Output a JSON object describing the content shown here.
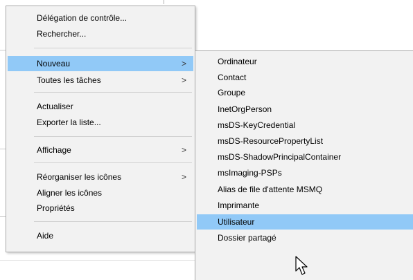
{
  "context_menu": {
    "items": [
      {
        "label": "Délégation de contrôle..."
      },
      {
        "label": "Rechercher..."
      },
      {
        "label": "Nouveau",
        "submenu": true,
        "arrow": ">"
      },
      {
        "label": "Toutes les tâches",
        "submenu": true,
        "arrow": ">"
      },
      {
        "label": "Actualiser"
      },
      {
        "label": "Exporter la liste..."
      },
      {
        "label": "Affichage",
        "submenu": true,
        "arrow": ">"
      },
      {
        "label": "Réorganiser les icônes",
        "submenu": true,
        "arrow": ">"
      },
      {
        "label": "Aligner les icônes"
      },
      {
        "label": "Propriétés"
      },
      {
        "label": "Aide"
      }
    ],
    "highlighted": "Nouveau"
  },
  "submenu_nouveau": {
    "items": [
      {
        "label": "Ordinateur"
      },
      {
        "label": "Contact"
      },
      {
        "label": "Groupe"
      },
      {
        "label": "InetOrgPerson"
      },
      {
        "label": "msDS-KeyCredential"
      },
      {
        "label": "msDS-ResourcePropertyList"
      },
      {
        "label": "msDS-ShadowPrincipalContainer"
      },
      {
        "label": "msImaging-PSPs"
      },
      {
        "label": "Alias de file d'attente MSMQ"
      },
      {
        "label": "Imprimante"
      },
      {
        "label": "Utilisateur"
      },
      {
        "label": "Dossier partagé"
      }
    ],
    "highlighted": "Utilisateur"
  },
  "colors": {
    "menu_background": "#f2f2f2",
    "highlight": "#91c9f7",
    "separator": "#d0d0d0",
    "border": "#a8a8a8"
  },
  "cursor": {
    "icon": "arrow-pointer-icon"
  }
}
